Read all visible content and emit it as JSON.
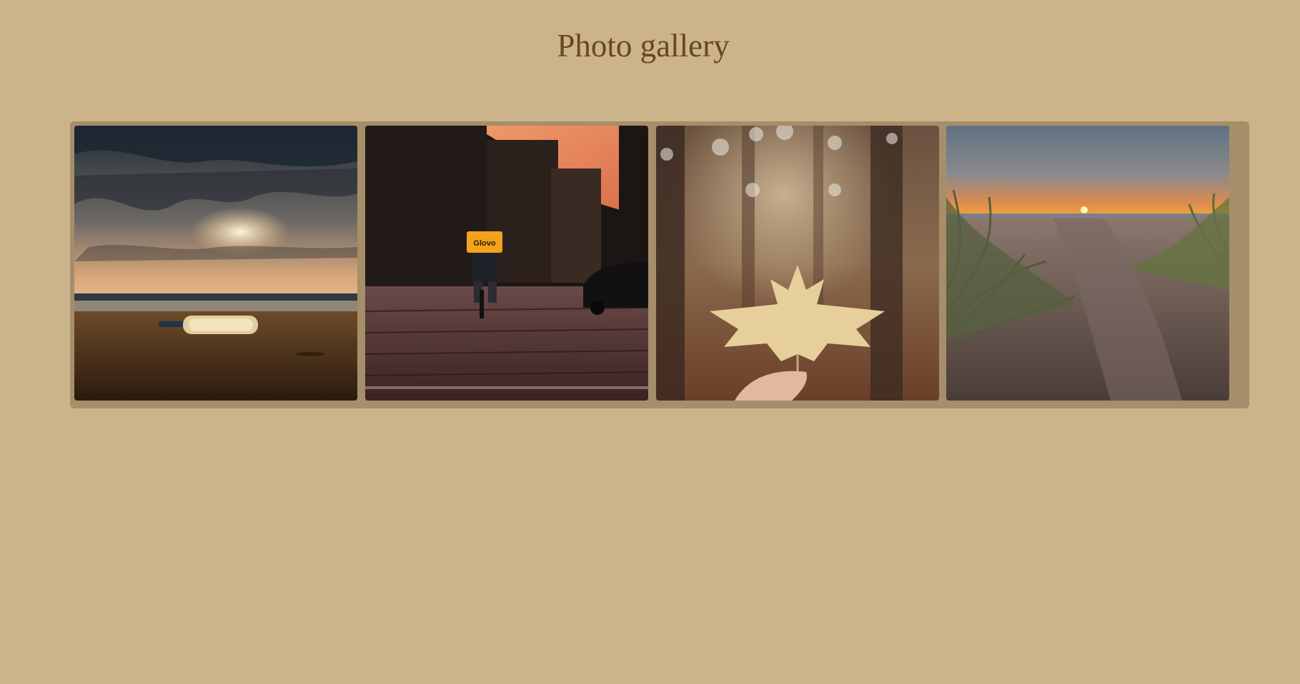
{
  "page": {
    "title": "Photo gallery"
  },
  "colors": {
    "background": "#cbb38a",
    "gallery_frame": "#a68e6a",
    "title": "#6b4523"
  },
  "gallery": {
    "photos": [
      {
        "name": "bottle-on-beach-at-sunset",
        "description": "glass bottle lying on a sandy beach under a cloudy sunset sky"
      },
      {
        "name": "courier-cycling-city-street",
        "description": "delivery cyclist with orange Glovo backpack on a cobbled street at dusk"
      },
      {
        "name": "hand-holding-autumn-leaf",
        "description": "hand holding a pale maple leaf in a blurred autumn forest"
      },
      {
        "name": "beach-dunes-sunset",
        "description": "sandy path between grassy dunes leading to the sea at sunset"
      }
    ],
    "photo2_sign": "Glovo"
  }
}
